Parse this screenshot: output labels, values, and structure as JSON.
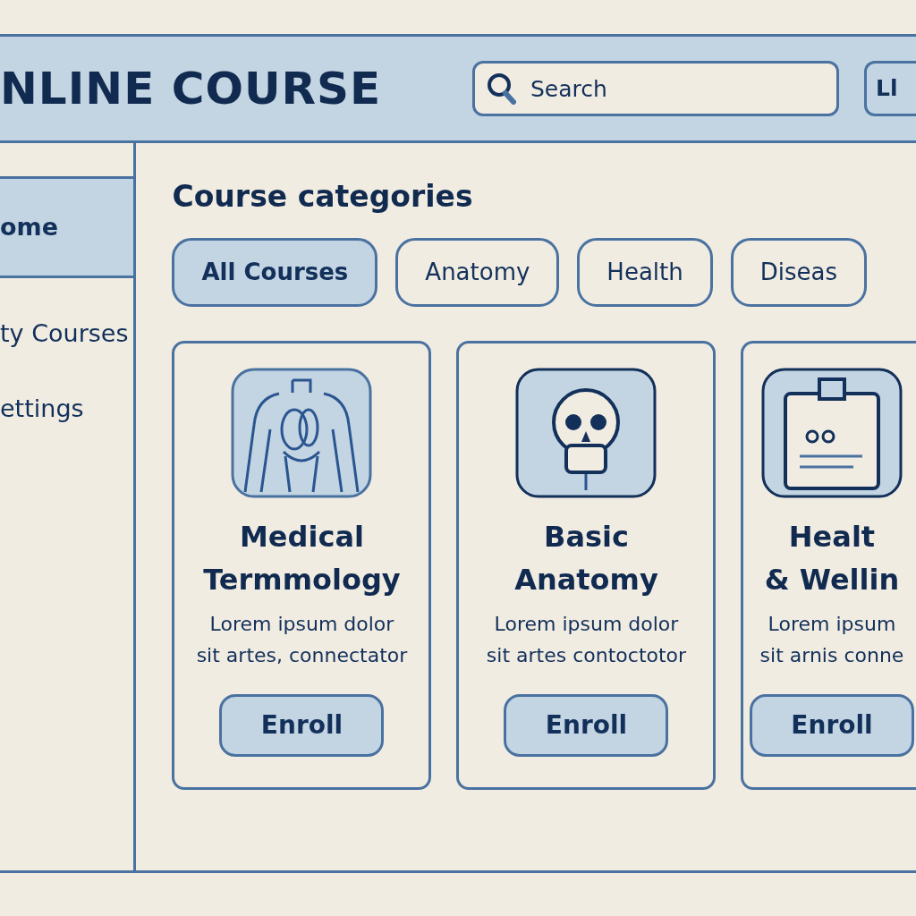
{
  "header": {
    "title": "NLINE COURSE",
    "search": {
      "placeholder": "Search"
    },
    "button": "Ll"
  },
  "sidebar": {
    "items": [
      {
        "label": "ome",
        "selected": true
      },
      {
        "label": "ty Courses",
        "selected": false
      },
      {
        "label": "ettings",
        "selected": false
      }
    ]
  },
  "main": {
    "heading": "Course categories",
    "categories": [
      {
        "label": "All Courses",
        "selected": true
      },
      {
        "label": "Anatomy",
        "selected": false
      },
      {
        "label": "Health",
        "selected": false
      },
      {
        "label": "Diseas",
        "selected": false
      }
    ],
    "courses": [
      {
        "kind": "torso",
        "title": "Medical\nTermmology",
        "description": "Lorem ipsum dolor\nsit artes, connectator",
        "button": "Enroll"
      },
      {
        "kind": "skull",
        "title": "Basic\nAnatomy",
        "description": "Lorem ipsum dolor\nsit artes  contoctotor",
        "button": "Enroll"
      },
      {
        "kind": "clipboard",
        "title": "Healt\n& Wellin",
        "description": "Lorem ipsum\nsit arnis conne",
        "button": "Enroll"
      }
    ]
  }
}
